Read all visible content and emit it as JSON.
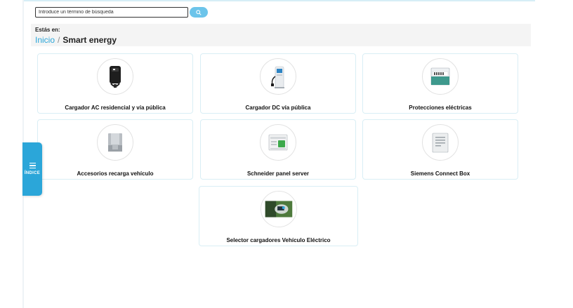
{
  "search": {
    "placeholder": "Introduce un término de búsqueda"
  },
  "breadcrumb": {
    "prefix": "Estás en:",
    "items": [
      "Inicio",
      "Smart energy"
    ],
    "separator": "/"
  },
  "sidebar_tab": {
    "label": "ÍNDICE"
  },
  "categories": [
    {
      "label": "Cargador AC residencial y vía pública",
      "icon": "ac-charger-icon"
    },
    {
      "label": "Cargador DC vía pública",
      "icon": "dc-charger-icon"
    },
    {
      "label": "Protecciones eléctricas",
      "icon": "electrical-panel-icon"
    },
    {
      "label": "Accesorios recarga vehículo",
      "icon": "charging-accessory-icon"
    },
    {
      "label": "Schneider panel server",
      "icon": "panel-server-icon"
    },
    {
      "label": "Siemens Connect Box",
      "icon": "connect-box-icon"
    },
    {
      "label": "Selector cargadores Vehículo Eléctrico",
      "icon": "ev-selector-icon"
    }
  ],
  "colors": {
    "accent": "#2ba6d9",
    "search_button": "#6cc4ea",
    "card_border": "#d9eef5"
  }
}
